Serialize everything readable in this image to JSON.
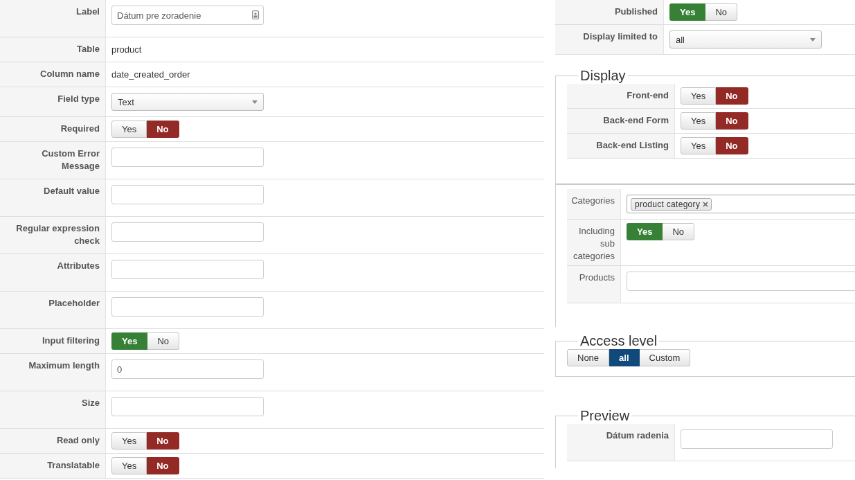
{
  "field_settings": [
    {
      "kind": "input",
      "label": "Label",
      "value": "Dátum pre zoradenie",
      "addon": true
    },
    {
      "kind": "text",
      "label": "Table",
      "value": "product"
    },
    {
      "kind": "text",
      "label": "Column name",
      "value": "date_created_order"
    },
    {
      "kind": "select",
      "label": "Field type",
      "value": "Text"
    },
    {
      "kind": "toggle",
      "label": "Required",
      "options": [
        {
          "label": "Yes",
          "kind": "yes",
          "selected": false
        },
        {
          "label": "No",
          "kind": "no",
          "selected": true
        }
      ]
    },
    {
      "kind": "input",
      "label": "Custom Error Message"
    },
    {
      "kind": "input",
      "label": "Default value"
    },
    {
      "kind": "input",
      "label": "Regular expression check"
    },
    {
      "kind": "input",
      "label": "Attributes"
    },
    {
      "kind": "input",
      "label": "Placeholder"
    },
    {
      "kind": "toggle",
      "label": "Input filtering",
      "options": [
        {
          "label": "Yes",
          "kind": "yes",
          "selected": true
        },
        {
          "label": "No",
          "kind": "no",
          "selected": false
        }
      ]
    },
    {
      "kind": "input",
      "label": "Maximum length",
      "value": "0"
    },
    {
      "kind": "input",
      "label": "Size"
    },
    {
      "kind": "toggle",
      "label": "Read only",
      "options": [
        {
          "label": "Yes",
          "kind": "yes",
          "selected": false
        },
        {
          "label": "No",
          "kind": "no",
          "selected": true
        }
      ]
    },
    {
      "kind": "toggle",
      "label": "Translatable",
      "options": [
        {
          "label": "Yes",
          "kind": "yes",
          "selected": false
        },
        {
          "label": "No",
          "kind": "no",
          "selected": true
        }
      ]
    }
  ],
  "publishing": [
    {
      "kind": "toggle",
      "label": "Published",
      "options": [
        {
          "label": "Yes",
          "kind": "yes",
          "selected": true
        },
        {
          "label": "No",
          "kind": "no",
          "selected": false
        }
      ]
    },
    {
      "kind": "select",
      "label": "Display limited to",
      "value": "all"
    }
  ],
  "display": {
    "legend": "Display",
    "rows": [
      {
        "kind": "toggle",
        "label": "Front-end",
        "options": [
          {
            "label": "Yes",
            "kind": "yes",
            "selected": false
          },
          {
            "label": "No",
            "kind": "no",
            "selected": true
          }
        ]
      },
      {
        "kind": "toggle",
        "label": "Back-end Form",
        "options": [
          {
            "label": "Yes",
            "kind": "yes",
            "selected": false
          },
          {
            "label": "No",
            "kind": "no",
            "selected": true
          }
        ]
      },
      {
        "kind": "toggle",
        "label": "Back-end Listing",
        "options": [
          {
            "label": "Yes",
            "kind": "yes",
            "selected": false
          },
          {
            "label": "No",
            "kind": "no",
            "selected": true
          }
        ]
      }
    ]
  },
  "assignment": {
    "rows": [
      {
        "kind": "tags",
        "label": "Categories",
        "tags": [
          "product category"
        ]
      },
      {
        "kind": "toggle",
        "label": "Including sub categories",
        "options": [
          {
            "label": "Yes",
            "kind": "yes",
            "selected": true
          },
          {
            "label": "No",
            "kind": "no",
            "selected": false
          }
        ]
      },
      {
        "kind": "input",
        "label": "Products"
      }
    ]
  },
  "access_level": {
    "legend": "Access level",
    "options": [
      {
        "label": "None",
        "kind": "other",
        "selected": false
      },
      {
        "label": "all",
        "kind": "other",
        "selected": true
      },
      {
        "label": "Custom",
        "kind": "other",
        "selected": false
      }
    ]
  },
  "preview": {
    "legend": "Preview",
    "rows": [
      {
        "kind": "input",
        "label": "Dátum radenia"
      }
    ]
  }
}
